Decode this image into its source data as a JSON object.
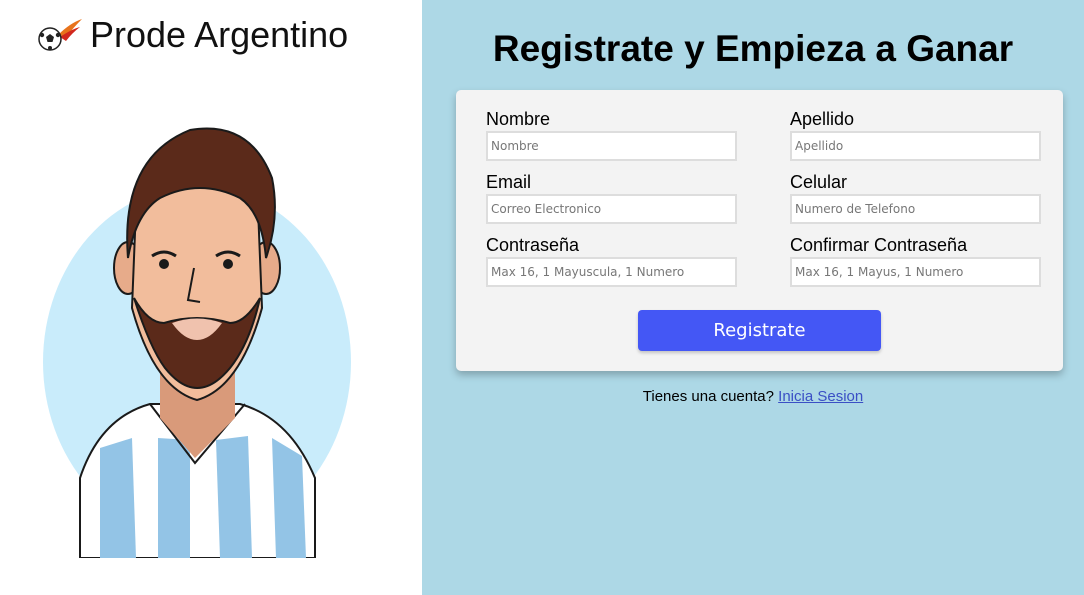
{
  "brand": {
    "title": "Prode Argentino",
    "icon": "soccer-ball-icon"
  },
  "portrait": {
    "icon": "player-portrait-illustration"
  },
  "page": {
    "title": "Registrate y Empieza a Ganar"
  },
  "form": {
    "fields": [
      {
        "label": "Nombre",
        "placeholder": "Nombre"
      },
      {
        "label": "Apellido",
        "placeholder": "Apellido"
      },
      {
        "label": "Email",
        "placeholder": "Correo Electronico"
      },
      {
        "label": "Celular",
        "placeholder": "Numero de Telefono"
      },
      {
        "label": "Contraseña",
        "placeholder": "Max 16, 1 Mayuscula, 1 Numero"
      },
      {
        "label": "Confirmar Contraseña",
        "placeholder": "Max 16, 1 Mayus, 1 Numero"
      }
    ],
    "submit_label": "Registrate"
  },
  "login": {
    "prompt": "Tienes una cuenta?",
    "link_label": "Inicia Sesion"
  },
  "colors": {
    "panel_bg": "#add8e6",
    "card_bg": "#f3f3f3",
    "button": "#4457f5",
    "link": "#3a4fc5"
  }
}
